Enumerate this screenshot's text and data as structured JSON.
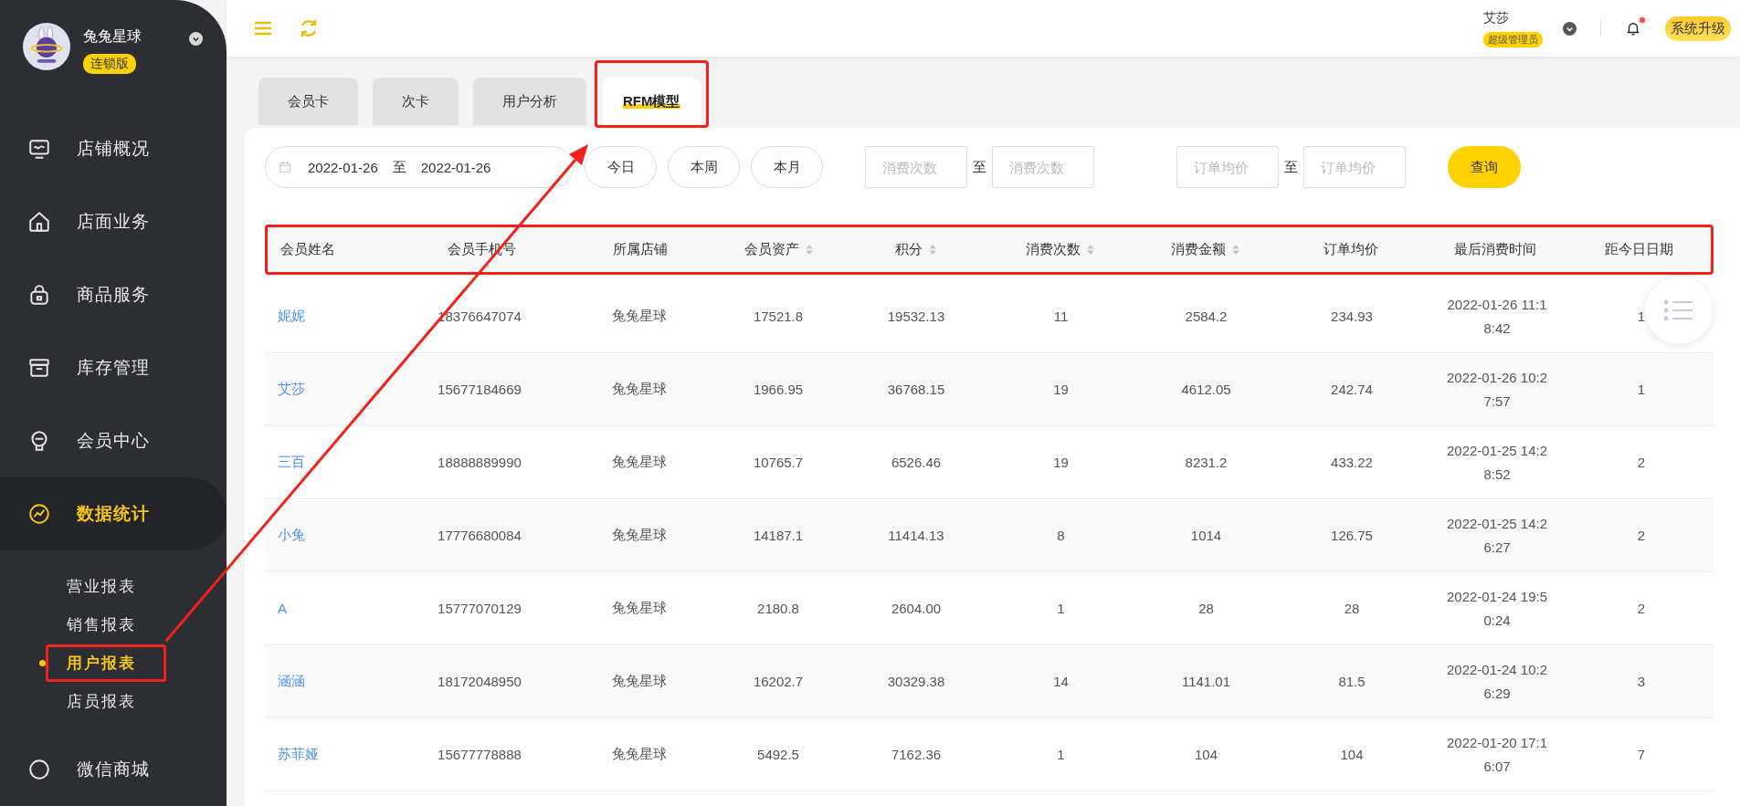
{
  "sidebar": {
    "store_name": "兔兔星球",
    "edition_badge": "连锁版",
    "nav": [
      {
        "label": "店铺概况",
        "selected": false
      },
      {
        "label": "店面业务",
        "selected": false
      },
      {
        "label": "商品服务",
        "selected": false
      },
      {
        "label": "库存管理",
        "selected": false
      },
      {
        "label": "会员中心",
        "selected": false
      },
      {
        "label": "数据统计",
        "selected": true,
        "children": [
          {
            "label": "营业报表",
            "selected": false,
            "highlighted": false
          },
          {
            "label": "销售报表",
            "selected": false,
            "highlighted": false
          },
          {
            "label": "用户报表",
            "selected": true,
            "highlighted": true
          },
          {
            "label": "店员报表",
            "selected": false,
            "highlighted": false
          }
        ]
      },
      {
        "label": "微信商城",
        "selected": false
      }
    ]
  },
  "topbar": {
    "user_name": "艾莎",
    "role_badge": "超级管理员",
    "notification_dot": true,
    "upgrade_button": "系统升级"
  },
  "tabs": [
    {
      "label": "会员卡",
      "selected": false,
      "highlighted": false
    },
    {
      "label": "次卡",
      "selected": false,
      "highlighted": false
    },
    {
      "label": "用户分析",
      "selected": false,
      "highlighted": false
    },
    {
      "label": "RFM模型",
      "selected": true,
      "highlighted": true
    }
  ],
  "filters": {
    "date_start": "2022-01-26",
    "date_separator": "至",
    "date_end": "2022-01-26",
    "quick_ranges": [
      "今日",
      "本周",
      "本月"
    ],
    "count_min": {
      "placeholder": "消费次数"
    },
    "count_separator": "至",
    "count_max": {
      "placeholder": "消费次数"
    },
    "avg_min": {
      "placeholder": "订单均价"
    },
    "avg_separator": "至",
    "avg_max": {
      "placeholder": "订单均价"
    },
    "search_button": "查询"
  },
  "table": {
    "header_highlighted": true,
    "columns": [
      {
        "label": "会员姓名",
        "sortable": false
      },
      {
        "label": "会员手机号",
        "sortable": false
      },
      {
        "label": "所属店铺",
        "sortable": false
      },
      {
        "label": "会员资产",
        "sortable": true
      },
      {
        "label": "积分",
        "sortable": true
      },
      {
        "label": "消费次数",
        "sortable": true
      },
      {
        "label": "消费金额",
        "sortable": true
      },
      {
        "label": "订单均价",
        "sortable": false
      },
      {
        "label": "最后消费时间",
        "sortable": false
      },
      {
        "label": "距今日日期",
        "sortable": false
      }
    ],
    "rows": [
      {
        "cells": [
          "妮妮",
          "18376647074",
          "兔兔星球",
          "17521.8",
          "19532.13",
          "11",
          "2584.2",
          "234.93",
          "2022-01-26 11:18:42",
          "1"
        ]
      },
      {
        "cells": [
          "艾莎",
          "15677184669",
          "兔兔星球",
          "1966.95",
          "36768.15",
          "19",
          "4612.05",
          "242.74",
          "2022-01-26 10:27:57",
          "1"
        ]
      },
      {
        "cells": [
          "三百",
          "18888889990",
          "兔兔星球",
          "10765.7",
          "6526.46",
          "19",
          "8231.2",
          "433.22",
          "2022-01-25 14:28:52",
          "2"
        ]
      },
      {
        "cells": [
          "小兔",
          "17776680084",
          "兔兔星球",
          "14187.1",
          "11414.13",
          "8",
          "1014",
          "126.75",
          "2022-01-25 14:26:27",
          "2"
        ]
      },
      {
        "cells": [
          "A",
          "15777070129",
          "兔兔星球",
          "2180.8",
          "2604.00",
          "1",
          "28",
          "28",
          "2022-01-24 19:50:24",
          "2"
        ]
      },
      {
        "cells": [
          "涵涵",
          "18172048950",
          "兔兔星球",
          "16202.7",
          "30329.38",
          "14",
          "1141.01",
          "81.5",
          "2022-01-24 10:26:29",
          "3"
        ]
      },
      {
        "cells": [
          "苏菲娅",
          "15677778888",
          "兔兔星球",
          "5492.5",
          "7162.36",
          "1",
          "104",
          "104",
          "2022-01-20 17:16:07",
          "7"
        ]
      }
    ]
  },
  "annotation_arrow": true
}
